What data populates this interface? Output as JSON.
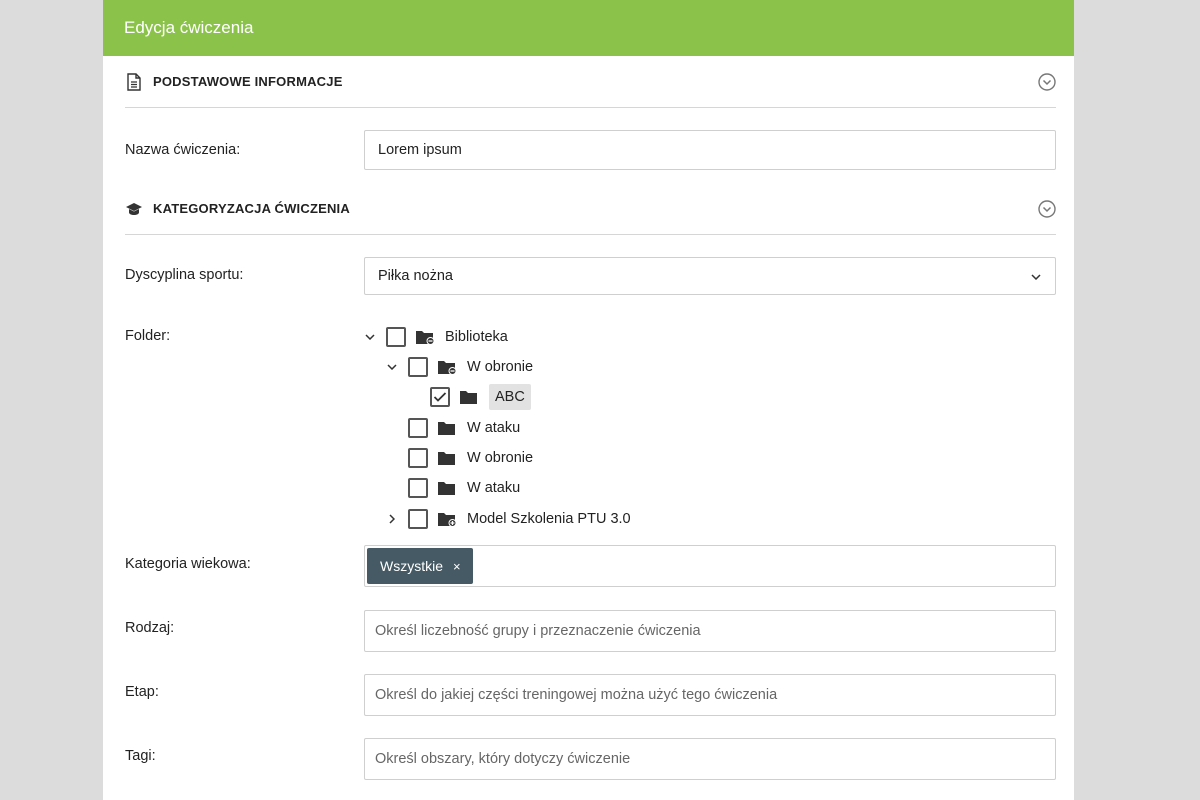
{
  "header": {
    "title": "Edycja ćwiczenia"
  },
  "sections": {
    "basic": {
      "title": "PODSTAWOWE INFORMACJE",
      "icon": "document-icon"
    },
    "category": {
      "title": "KATEGORYZACJA ĆWICZENIA",
      "icon": "graduation-cap-icon"
    }
  },
  "fields": {
    "name": {
      "label": "Nazwa ćwiczenia:",
      "value": "Lorem ipsum"
    },
    "discipline": {
      "label": "Dyscyplina sportu:",
      "value": "Piłka nożna"
    },
    "folder": {
      "label": "Folder:"
    },
    "age": {
      "label": "Kategoria wiekowa:",
      "tag": "Wszystkie",
      "tag_remove": "×"
    },
    "type": {
      "label": "Rodzaj:",
      "placeholder": "Określ liczebność grupy i przeznaczenie ćwiczenia"
    },
    "stage": {
      "label": "Etap:",
      "placeholder": "Określ do jakiej części treningowej można użyć tego ćwiczenia"
    },
    "tags": {
      "label": "Tagi:",
      "placeholder": "Określ obszary, który dotyczy ćwiczenie"
    }
  },
  "tree": [
    {
      "label": "Biblioteka",
      "checked": false,
      "toggle": "expanded"
    },
    {
      "label": "W obronie",
      "checked": false,
      "toggle": "expanded"
    },
    {
      "label": "ABC",
      "checked": true,
      "toggle": "none"
    },
    {
      "label": "W ataku",
      "checked": false,
      "toggle": "none"
    },
    {
      "label": "W obronie",
      "checked": false,
      "toggle": "none"
    },
    {
      "label": "W ataku",
      "checked": false,
      "toggle": "none"
    },
    {
      "label": "Model Szkolenia PTU 3.0",
      "checked": false,
      "toggle": "collapsed"
    }
  ],
  "colors": {
    "header": "#8bc34a",
    "tag": "#455a64",
    "background": "#dcdcdc"
  }
}
